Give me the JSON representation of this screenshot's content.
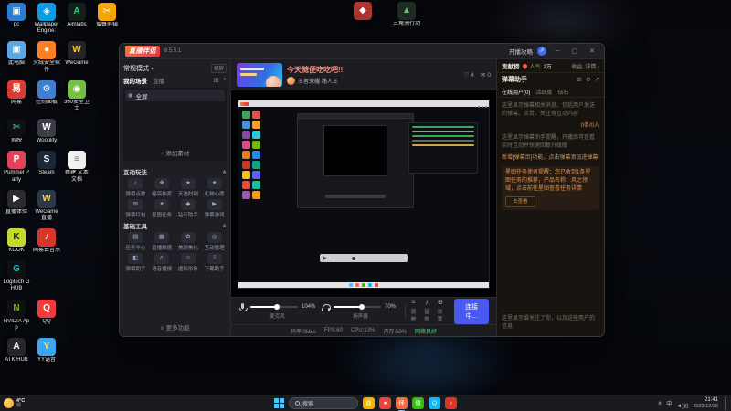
{
  "desktop": {
    "rows": [
      [
        {
          "id": "pc",
          "label": "pc",
          "glyph": "▣",
          "bg": "#2b7cd3"
        },
        {
          "id": "wallpaper-engine",
          "label": "Wallpaper Engine:",
          "glyph": "◈",
          "bg": "#0a9be0"
        },
        {
          "id": "aimlabs",
          "label": "Aimlabs",
          "glyph": "A",
          "bg": "#13201a",
          "fg": "#35d07f"
        },
        {
          "id": "bee-clip",
          "label": "蜜蜂剪辑",
          "glyph": "✂",
          "bg": "#f7a600"
        }
      ],
      [
        {
          "id": "this-pc",
          "label": "此电脑",
          "glyph": "▣",
          "bg": "#5aa7e8"
        },
        {
          "id": "huorong",
          "label": "火绒安全软件",
          "glyph": "●",
          "bg": "#ff7f27"
        },
        {
          "id": "wegame",
          "label": "WeGame",
          "glyph": "W",
          "bg": "#23252a",
          "fg": "#ffcf40"
        }
      ],
      [
        {
          "id": "netease",
          "label": "网易",
          "glyph": "易",
          "bg": "#d93a31"
        },
        {
          "id": "control-panel",
          "label": "控制面板",
          "glyph": "⚙",
          "bg": "#3f7fd0"
        },
        {
          "id": "360-safe",
          "label": "360安全卫士",
          "glyph": "◉",
          "bg": "#7ac143"
        }
      ],
      [
        {
          "id": "jianying",
          "label": "剪映",
          "glyph": "✄",
          "bg": "#101014",
          "fg": "#40e0d0"
        },
        {
          "id": "wootility",
          "label": "Wootility",
          "glyph": "W",
          "bg": "#3a3d44"
        }
      ],
      [
        {
          "id": "pummel-party",
          "label": "Pummel Party",
          "glyph": "P",
          "bg": "#e0435a"
        },
        {
          "id": "steam",
          "label": "Steam",
          "glyph": "S",
          "bg": "#1b2838"
        },
        {
          "id": "new-text-doc",
          "label": "新建 文本文档",
          "glyph": "≡",
          "bg": "#f2f2f2",
          "fg": "#777777"
        }
      ],
      [
        {
          "id": "live-trial",
          "label": "直播体验",
          "glyph": "▶",
          "bg": "#2a2a30"
        },
        {
          "id": "wegame-live",
          "label": "WeGame直播",
          "glyph": "W",
          "bg": "#2b3a4a",
          "fg": "#ffcf40"
        }
      ],
      [
        {
          "id": "kook",
          "label": "KOOK",
          "glyph": "K",
          "bg": "#c4d82e",
          "fg": "#222222"
        },
        {
          "id": "netease-music",
          "label": "网易云音乐",
          "glyph": "♪",
          "bg": "#d8362a"
        }
      ],
      [
        {
          "id": "ghub",
          "label": "Logitech G HUB",
          "glyph": "G",
          "bg": "#101014",
          "fg": "#00b8c8"
        }
      ],
      [
        {
          "id": "nvidia-app",
          "label": "NVIDIA App",
          "glyph": "N",
          "bg": "#101014",
          "fg": "#76b900"
        },
        {
          "id": "qq",
          "label": "QQ",
          "glyph": "Q",
          "bg": "#ef3b3b"
        }
      ],
      [
        {
          "id": "atk-hub",
          "label": "ATK HUB",
          "glyph": "A",
          "bg": "#26262c"
        },
        {
          "id": "yy",
          "label": "YY语音",
          "glyph": "Y",
          "bg": "#3aa7f0",
          "fg": "#ffe14d"
        }
      ]
    ],
    "top_icons": [
      {
        "id": "game-shortcut",
        "label": "",
        "glyph": "◆",
        "bg": "#b03434"
      },
      {
        "id": "delta-force",
        "label": "三角洲行动",
        "glyph": "▲",
        "bg": "#1f2c24",
        "fg": "#58d07a"
      }
    ]
  },
  "window": {
    "logo": "直播伴侣",
    "version": "8.5.5.1",
    "guide_label": "开播攻略",
    "share_glyph": "⇗",
    "controls": {
      "minimize": "─",
      "maximize": "▢",
      "close": "✕"
    },
    "header": {
      "stream_title": "今天随便吃吃吧!!",
      "stream_sub": "王者荣耀·路人王",
      "stats": [
        {
          "id": "likes",
          "glyph": "♡",
          "value": "4"
        },
        {
          "id": "comments",
          "glyph": "✉",
          "value": "0"
        }
      ]
    },
    "left": {
      "mode_label": "常规模式",
      "mode_caret": "▾",
      "orientation": "横屏",
      "tabs": [
        {
          "label": "我的场景",
          "active": true
        },
        {
          "label": "直播",
          "active": false
        }
      ],
      "panel_icons": [
        "⊞",
        "+"
      ],
      "scene_icon": "▣",
      "scene_item": "全屏",
      "add_material": "+ 添加素材",
      "section_caret": "∧",
      "more_caret": "∨",
      "more_label": "更多功能",
      "sections": [
        {
          "title": "互动玩法",
          "items": [
            {
              "label": "弹幕点歌",
              "glyph": "♪"
            },
            {
              "label": "福袋抽奖",
              "glyph": "❖"
            },
            {
              "label": "天选时刻",
              "glyph": "★"
            },
            {
              "label": "礼物心愿",
              "glyph": "♥"
            },
            {
              "label": "弹幕红包",
              "glyph": "✉"
            },
            {
              "label": "星图任务",
              "glyph": "✦"
            },
            {
              "label": "钻石助手",
              "glyph": "◆"
            },
            {
              "label": "弹幕游戏",
              "glyph": "▶"
            }
          ]
        },
        {
          "title": "基础工具",
          "items": [
            {
              "label": "任务中心",
              "glyph": "▤"
            },
            {
              "label": "直播数据",
              "glyph": "▦"
            },
            {
              "label": "美颜美化",
              "glyph": "✿"
            },
            {
              "label": "互动管理",
              "glyph": "◎"
            },
            {
              "label": "弹幕助手",
              "glyph": "◧"
            },
            {
              "label": "语音播报",
              "glyph": "♬"
            },
            {
              "label": "虚拟形象",
              "glyph": "☺"
            },
            {
              "label": "下载助手",
              "glyph": "⇩"
            }
          ]
        }
      ]
    },
    "preview": {
      "icon_colors": [
        "#3ba55d",
        "#d9534f",
        "#4a90d9",
        "#e8a33d",
        "#8e44ad",
        "#27cdd6",
        "#d94a8c",
        "#74b816",
        "#e67e22",
        "#2e86de",
        "#c0392b",
        "#16a085",
        "#f1c40f",
        "#5865f2",
        "#e74c3c",
        "#1abc9c",
        "#9b59b6",
        "#f39c12"
      ],
      "console_lines": [
        "#3ba55d",
        "#9a9a9a",
        "#3ba55d",
        "#6a6a6a",
        "#caa84a"
      ],
      "taskbar_dots": [
        "#4cc2ff",
        "#ff6a3d",
        "#2dc100",
        "#12b7f5",
        "#e8453c"
      ],
      "play_glyph": "▶"
    },
    "audio": {
      "mic": {
        "label": "麦克风",
        "value": "104%",
        "fill": 55
      },
      "speaker": {
        "label": "扬声器",
        "value": "70%",
        "fill": 60
      },
      "tools": [
        {
          "id": "reverb",
          "label": "混响",
          "glyph": "≈"
        },
        {
          "id": "sound-effect",
          "label": "音效",
          "glyph": "♪"
        },
        {
          "id": "settings",
          "label": "设置",
          "glyph": "⚙"
        }
      ],
      "live_button": "连接中..."
    },
    "status": {
      "items": [
        "码率:0kb/s",
        "FPS:60",
        "CPU:13%",
        "内存:50%"
      ],
      "network": "网络良好"
    },
    "right": {
      "rank_tab": "贡献榜",
      "popularity_label": "人气",
      "popularity_value": "2万",
      "income_label": "收益",
      "detail_label": "详情 ›",
      "assistant_title": "弹幕助手",
      "toolbar_icons": [
        "⊞",
        "⚙",
        "↗"
      ],
      "tabs": [
        {
          "label": "在线用户(0)",
          "active": true
        },
        {
          "label": "活跃度",
          "active": false
        },
        {
          "label": "钻石",
          "active": false
        }
      ],
      "messages": [
        {
          "type": "hint",
          "text": "这里显示弹幕相关消息，包括用户发送的弹幕、点赞、关注等互动内容"
        },
        {
          "type": "stat",
          "text": "0条/0人"
        },
        {
          "type": "hint",
          "text": "这里显示弹幕助手提醒，开播后可查看实时互动并快速回复升级版"
        },
        {
          "type": "notice",
          "text": "新增[弹幕页]功能，点击弹幕添加进弹幕"
        },
        {
          "type": "task",
          "text": "星图任务使者提醒：您已收到1条星图任务的推荐，产品名称：风之领域，点击前往星图查看任务详情",
          "button": "去查看"
        }
      ],
      "footer": "这里显示谁关注了你，以及这些用户的信息"
    }
  },
  "taskbar": {
    "weather": {
      "temp": "4°C",
      "desc": "晴",
      "glyph": "☀"
    },
    "search_label": "搜索",
    "apps": [
      {
        "id": "file-explorer",
        "glyph": "▤",
        "bg": "#f4b400",
        "active": false
      },
      {
        "id": "browser",
        "glyph": "●",
        "bg": "#e8453c",
        "active": false
      },
      {
        "id": "live-companion",
        "glyph": "伴",
        "bg": "#ff6a3d",
        "active": true
      },
      {
        "id": "wechat",
        "glyph": "微",
        "bg": "#2dc100",
        "active": false
      },
      {
        "id": "qq",
        "glyph": "Q",
        "bg": "#12b7f5",
        "active": false
      },
      {
        "id": "music",
        "glyph": "♪",
        "bg": "#d8362a",
        "active": false
      }
    ],
    "tray": {
      "chevron": "∧",
      "ime": "中",
      "icons": [
        "◄))",
        "▯"
      ],
      "time": "21:41",
      "date": "2023/12/28"
    }
  }
}
